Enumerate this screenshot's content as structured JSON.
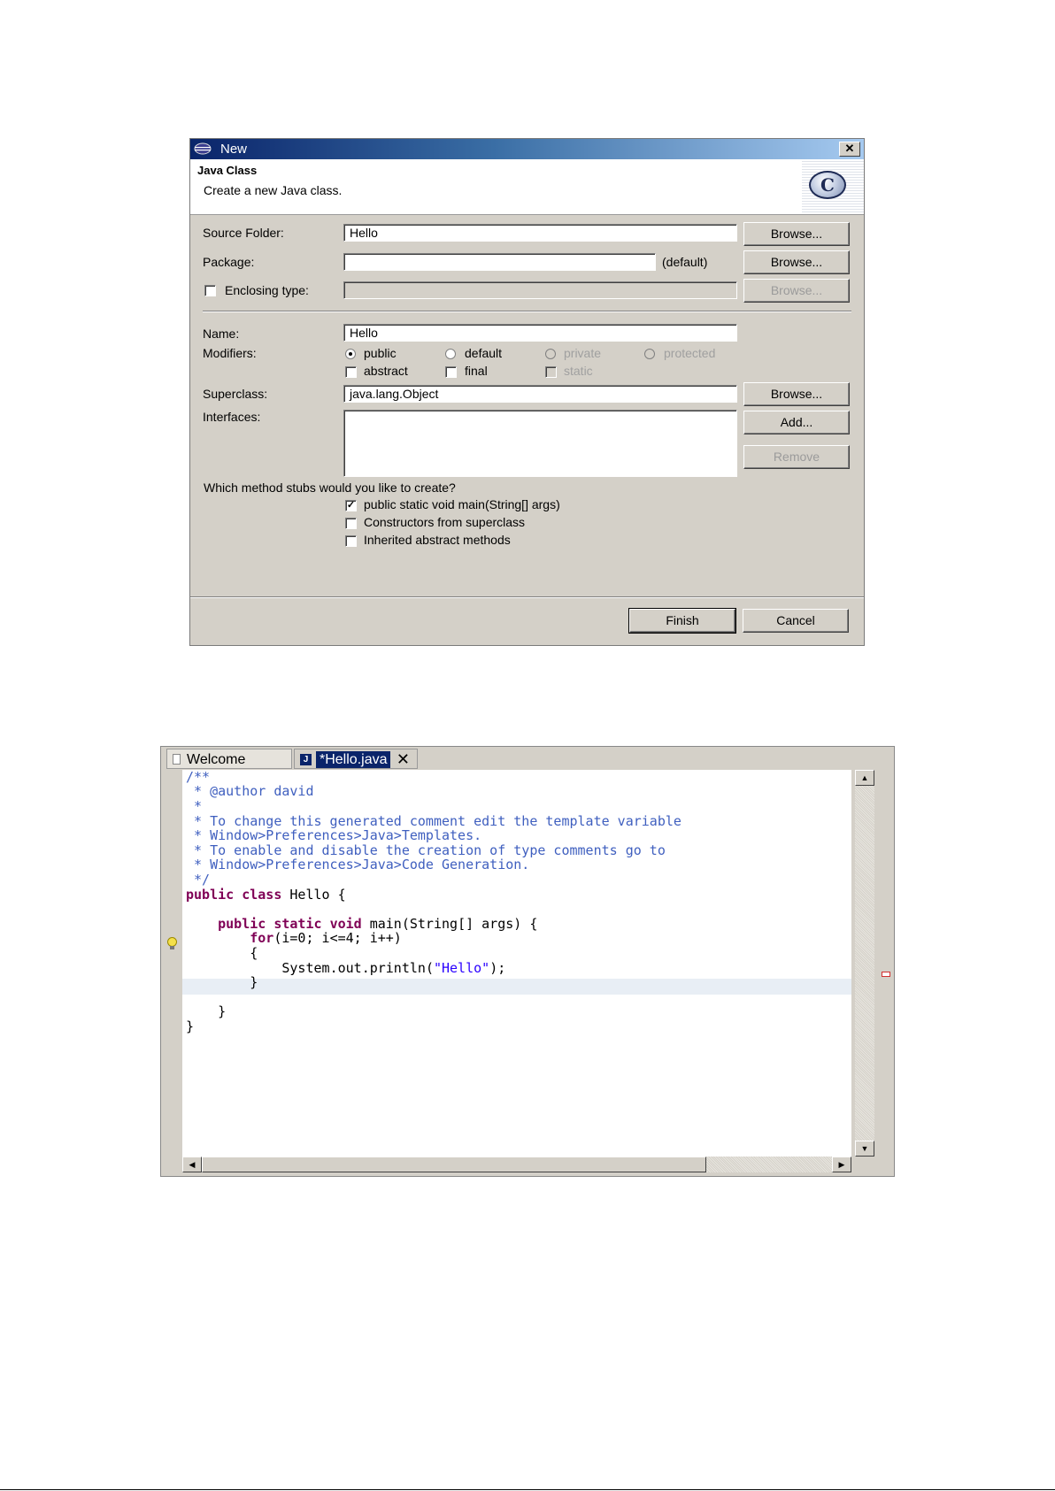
{
  "dialog": {
    "window_title": "New",
    "close_glyph": "✕",
    "heading": "Java Class",
    "description": "Create a new Java class.",
    "logo_letter": "C",
    "source_folder": {
      "label": "Source Folder:",
      "value": "Hello",
      "button": "Browse..."
    },
    "package": {
      "label": "Package:",
      "value": "",
      "suffix": "(default)",
      "button": "Browse..."
    },
    "enclosing": {
      "label": "Enclosing type:",
      "checked": false,
      "value": "",
      "button": "Browse..."
    },
    "name": {
      "label": "Name:",
      "value": "Hello"
    },
    "modifiers": {
      "label": "Modifiers:",
      "radios": [
        "public",
        "default",
        "private",
        "protected"
      ],
      "selected": "public",
      "checkboxes": [
        "abstract",
        "final",
        "static"
      ]
    },
    "superclass": {
      "label": "Superclass:",
      "value": "java.lang.Object",
      "button": "Browse..."
    },
    "interfaces": {
      "label": "Interfaces:",
      "add_button": "Add...",
      "remove_button": "Remove"
    },
    "stubs": {
      "question": "Which method stubs would you like to create?",
      "options": [
        {
          "label": "public static void main(String[] args)",
          "checked": true
        },
        {
          "label": "Constructors from superclass",
          "checked": false
        },
        {
          "label": "Inherited abstract methods",
          "checked": false
        }
      ]
    },
    "finish_button": "Finish",
    "cancel_button": "Cancel"
  },
  "editor": {
    "tabs": [
      {
        "label": "Welcome",
        "active": false
      },
      {
        "label": "*Hello.java",
        "active": true
      }
    ],
    "tab_close_glyph": "✕",
    "java_icon_glyph": "J",
    "code_lines": [
      "/**",
      " * @author david",
      " *",
      " * To change this generated comment edit the template variable",
      " * Window>Preferences>Java>Templates.",
      " * To enable and disable the creation of type comments go to",
      " * Window>Preferences>Java>Code Generation.",
      " */",
      "public class Hello {",
      "",
      "    public static void main(String[] args) {",
      "        for(i=0; i<=4; i++)",
      "        {",
      "            System.out.println(\"Hello\");",
      "        }",
      "",
      "    }",
      "}"
    ],
    "scroll_glyphs": {
      "up": "▲",
      "down": "▼",
      "left": "◀",
      "right": "▶"
    }
  }
}
